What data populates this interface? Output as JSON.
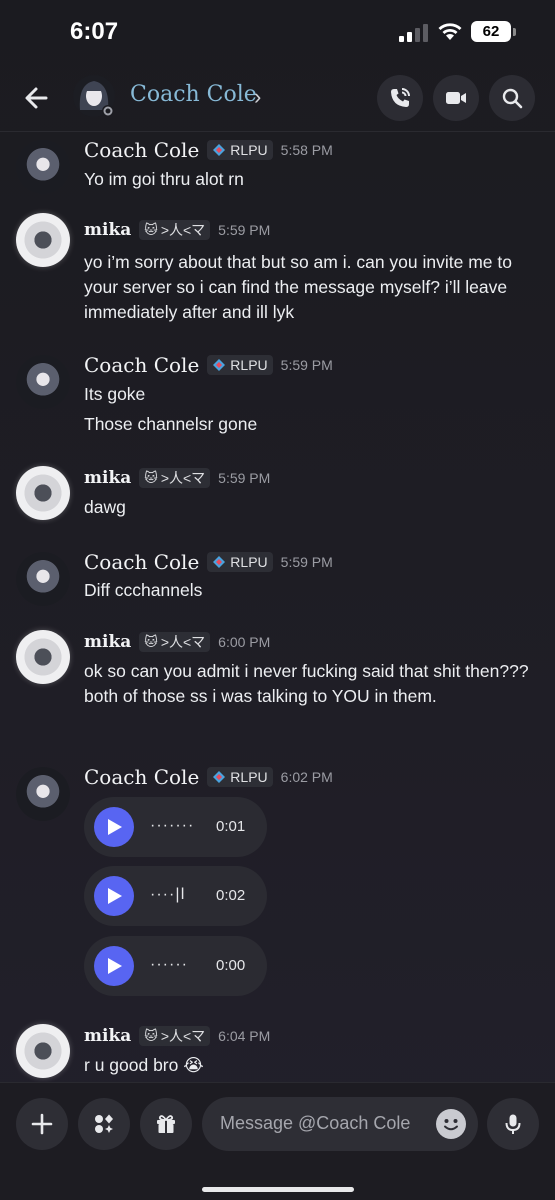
{
  "status_bar": {
    "time": "6:07",
    "battery": "62",
    "icons": [
      "signal-icon",
      "wifi-icon",
      "battery-icon"
    ]
  },
  "header": {
    "title": "Coach Cole",
    "chevron": "›",
    "icons": [
      "back-arrow-icon",
      "call-icon",
      "video-icon",
      "search-icon"
    ]
  },
  "messages": [
    {
      "author": "Coach Cole",
      "tag": "RLPU",
      "time": "5:58 PM",
      "lines": [
        "Yo im goi thru alot rn"
      ]
    },
    {
      "author": "mika",
      "tag": ">人<マ",
      "time": "5:59 PM",
      "lines": [
        "yo i’m sorry about that but so am i. can you invite me to your server so i can find the message myself? i’ll leave immediately after and ill lyk"
      ]
    },
    {
      "author": "Coach Cole",
      "tag": "RLPU",
      "time": "5:59 PM",
      "lines": [
        "Its goke",
        "Those channelsr gone"
      ]
    },
    {
      "author": "mika",
      "tag": ">人<マ",
      "time": "5:59 PM",
      "lines": [
        "dawg"
      ]
    },
    {
      "author": "Coach Cole",
      "tag": "RLPU",
      "time": "5:59 PM",
      "lines": [
        "Diff ccchannels"
      ]
    },
    {
      "author": "mika",
      "tag": ">人<マ",
      "time": "6:00 PM",
      "lines": [
        "ok so can you admit i never fucking said that shit then??? both of those ss i was talking to YOU in them."
      ]
    },
    {
      "author": "Coach Cole",
      "tag": "RLPU",
      "time": "6:02 PM",
      "voice": [
        {
          "waveform": "·······",
          "duration": "0:01"
        },
        {
          "waveform": "····|ǀ",
          "duration": "0:02"
        },
        {
          "waveform": "······",
          "duration": "0:00"
        }
      ]
    },
    {
      "author": "mika",
      "tag": ">人<マ",
      "time": "6:04 PM",
      "lines": [
        "r u good bro 😭"
      ]
    }
  ],
  "composer": {
    "placeholder": "Message @Coach Cole",
    "icons": [
      "plus-icon",
      "apps-icon",
      "gift-icon",
      "emoji-icon",
      "microphone-icon"
    ]
  },
  "colors": {
    "accent": "#5865f2",
    "header_title": "#87b9d6",
    "background": "#1e1d24"
  }
}
